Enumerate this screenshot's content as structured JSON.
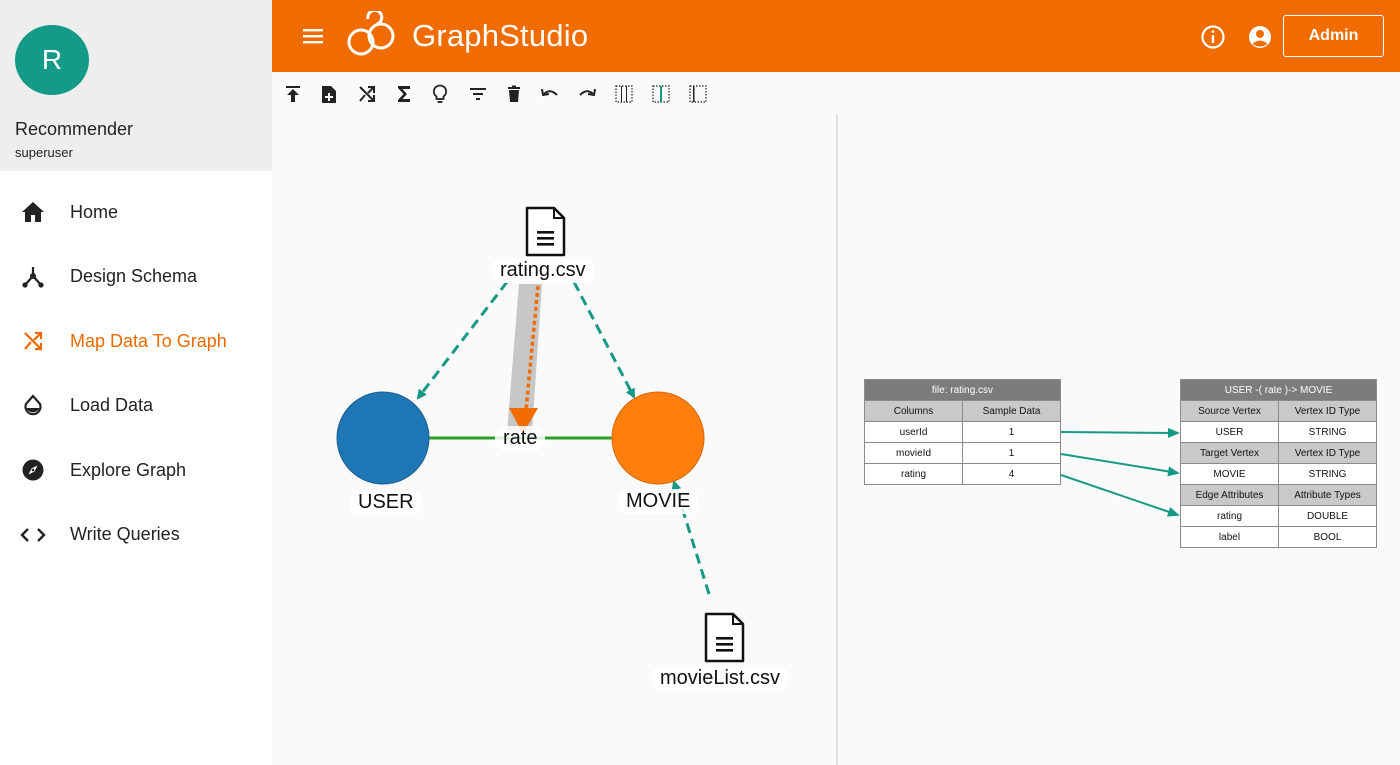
{
  "sidebar": {
    "avatar_letter": "R",
    "graph_name": "Recommender",
    "user_role": "superuser",
    "items": [
      {
        "label": "Home",
        "icon": "home-icon",
        "active": false
      },
      {
        "label": "Design Schema",
        "icon": "schema-icon",
        "active": false
      },
      {
        "label": "Map Data To Graph",
        "icon": "shuffle-icon",
        "active": true
      },
      {
        "label": "Load Data",
        "icon": "drop-icon",
        "active": false
      },
      {
        "label": "Explore Graph",
        "icon": "compass-icon",
        "active": false
      },
      {
        "label": "Write Queries",
        "icon": "code-icon",
        "active": false
      }
    ]
  },
  "header": {
    "logo_text_graph": "Graph",
    "logo_text_studio": "Studio",
    "admin_label": "Admin"
  },
  "toolbar": {
    "tools": [
      "upload-icon",
      "add-file-icon",
      "shuffle-icon",
      "sigma-icon",
      "lightbulb-icon",
      "filter-icon",
      "delete-icon",
      "undo-icon",
      "redo-icon",
      "grid-icon",
      "grid-center-icon",
      "grid-right-icon"
    ]
  },
  "canvas": {
    "files": [
      {
        "label": "rating.csv"
      },
      {
        "label": "movieList.csv"
      }
    ],
    "vertices": [
      {
        "label": "USER",
        "color": "#1f76b4"
      },
      {
        "label": "MOVIE",
        "color": "#ff7f0e"
      }
    ],
    "edge": {
      "label": "rate",
      "color": "#2aa02a"
    },
    "mapping_color": "#169a85",
    "selected_mapping_color": "#f06c00"
  },
  "source_table": {
    "title": "file: rating.csv",
    "headers": [
      "Columns",
      "Sample Data"
    ],
    "rows": [
      [
        "userId",
        "1"
      ],
      [
        "movieId",
        "1"
      ],
      [
        "rating",
        "4"
      ]
    ]
  },
  "target_table": {
    "title": "USER -( rate )-> MOVIE",
    "rows": [
      {
        "type": "head",
        "cells": [
          "Source Vertex",
          "Vertex ID Type"
        ]
      },
      {
        "type": "data",
        "cells": [
          "USER",
          "STRING"
        ]
      },
      {
        "type": "head",
        "cells": [
          "Target Vertex",
          "Vertex ID Type"
        ]
      },
      {
        "type": "data",
        "cells": [
          "MOVIE",
          "STRING"
        ]
      },
      {
        "type": "head",
        "cells": [
          "Edge Attributes",
          "Attribute Types"
        ]
      },
      {
        "type": "data",
        "cells": [
          "rating",
          "DOUBLE"
        ]
      },
      {
        "type": "data",
        "cells": [
          "label",
          "BOOL"
        ]
      }
    ]
  }
}
